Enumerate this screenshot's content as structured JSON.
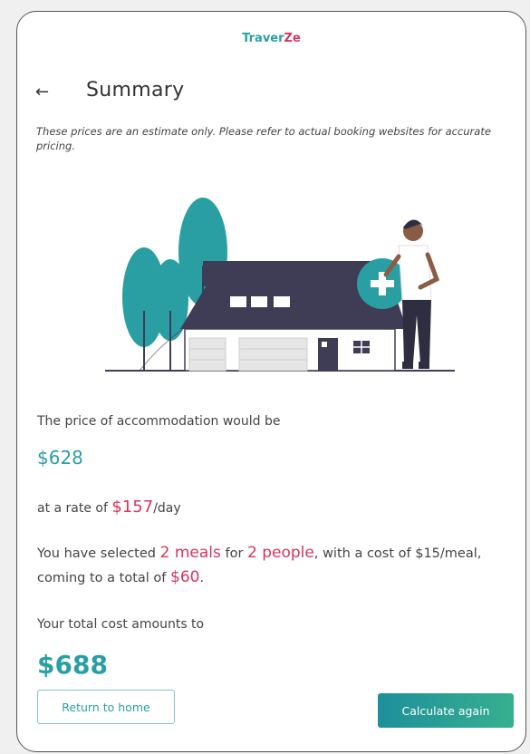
{
  "brand": {
    "part1": "Traver",
    "part2": "Ze"
  },
  "header": {
    "back_icon": "←",
    "title": "Summary"
  },
  "disclaimer": "These prices are an estimate only. Please refer to actual booking websites for accurate pricing.",
  "accommodation": {
    "label": "The price of accommodation would be",
    "price": "$628",
    "rate_prefix": "at a rate of ",
    "rate_value": "$157",
    "rate_suffix": "/day"
  },
  "meals": {
    "text1": "You have selected ",
    "meals_count": "2 meals",
    "text2": " for ",
    "people_count": "2 people",
    "text3": ", with a cost of $15/meal, coming to a total of ",
    "meals_total": "$60",
    "text4": "."
  },
  "total": {
    "label": "Your total cost amounts to",
    "value": "$688"
  },
  "buttons": {
    "home": "Return to home",
    "calculate": "Calculate again"
  },
  "colors": {
    "accent_teal": "#2a9fa3",
    "accent_pink": "#d8345f",
    "house_dark": "#3f3d56"
  }
}
